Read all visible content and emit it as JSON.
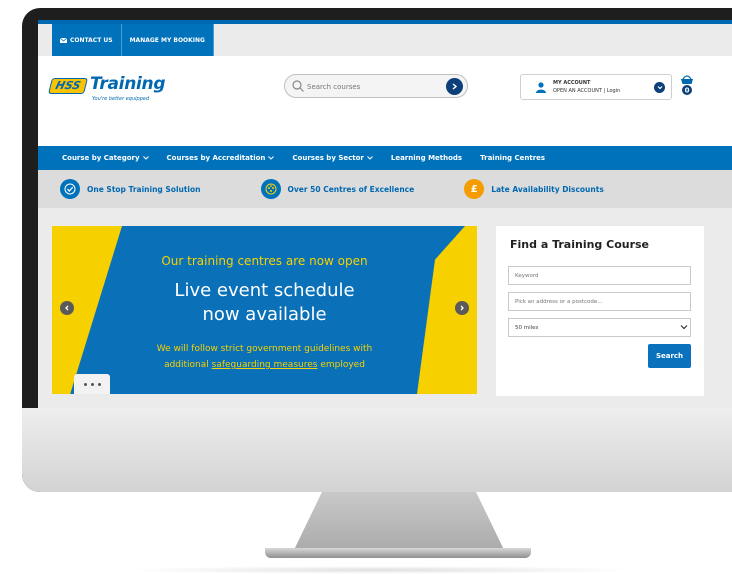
{
  "topbar": {
    "contact_label": "CONTACT US",
    "booking_label": "MANAGE MY BOOKING"
  },
  "brand": {
    "logo_badge": "HSS",
    "logo_word": "Training",
    "tagline": "You're better equipped"
  },
  "search": {
    "placeholder": "Search courses"
  },
  "account": {
    "title": "MY ACCOUNT",
    "links": "OPEN AN ACCOUNT | Login"
  },
  "basket": {
    "count": "0"
  },
  "nav": {
    "items": [
      {
        "label": "Course by Category",
        "dropdown": true
      },
      {
        "label": "Courses by Accreditation",
        "dropdown": true
      },
      {
        "label": "Courses by Sector",
        "dropdown": true
      },
      {
        "label": "Learning Methods",
        "dropdown": false
      },
      {
        "label": "Training Centres",
        "dropdown": false
      }
    ]
  },
  "usp": {
    "items": [
      {
        "label": "One Stop Training Solution",
        "icon": "check-icon"
      },
      {
        "label": "Over 50 Centres of Excellence",
        "icon": "stars-icon"
      },
      {
        "label": "Late Availability Discounts",
        "icon": "pound-icon"
      }
    ]
  },
  "hero": {
    "line1": "Our training centres are now open",
    "line2": "Live event schedule",
    "line3": "now available",
    "line4": "We will follow strict government guidelines with",
    "line5_pre": "additional ",
    "line5_link": "safeguarding measures",
    "line5_post": " employed"
  },
  "find_course": {
    "heading": "Find a Training Course",
    "keyword_placeholder": "Keyword",
    "postcode_placeholder": "Pick an address or a postcode...",
    "radius_value": "50 miles",
    "search_label": "Search"
  },
  "colors": {
    "brand_blue": "#0072bc",
    "brand_yellow": "#f8d200"
  }
}
